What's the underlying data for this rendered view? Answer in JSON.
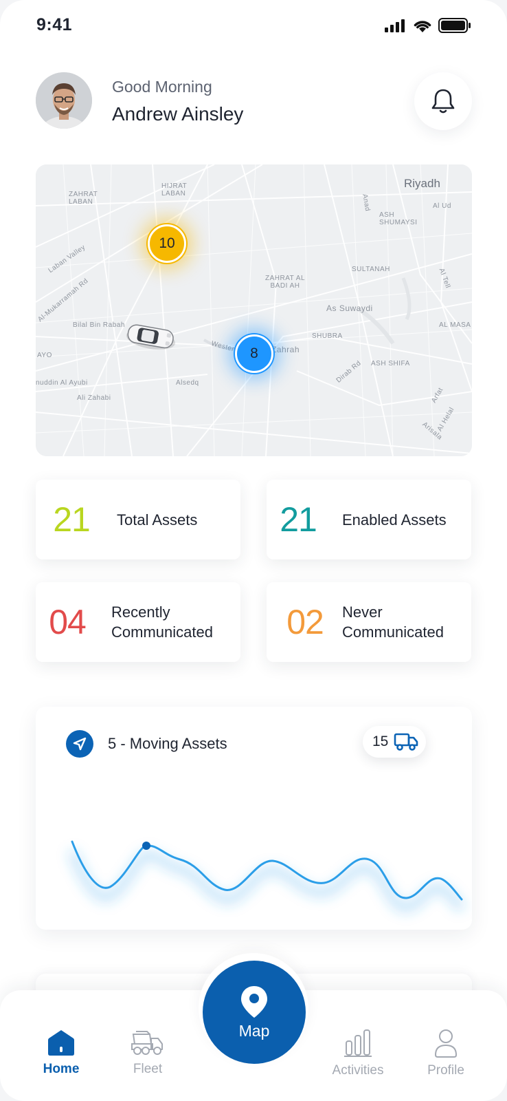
{
  "status_bar": {
    "time": "9:41"
  },
  "header": {
    "greeting": "Good Morning",
    "user_name": "Andrew Ainsley"
  },
  "map": {
    "labels": [
      "Riyadh",
      "HIJRAT LABAN",
      "ZAHRAT LABAN",
      "Al Ud",
      "ASH SHUMAYSI",
      "SULTANAH",
      "ZAHRAT AL BADI AH",
      "As Suwaydi",
      "SHUBRA",
      "AL MASA",
      "Bilal Bin Rabah",
      "Laban Valley",
      "Al-Mukarramah Rd",
      "Western",
      "Zahrah",
      "ASH SHIFA",
      "Dirab Rd",
      "Alsedq",
      "Ali Zahabi",
      "nuddin Al Ayubi",
      "Al Tell",
      "Arfat",
      "Al Helal",
      "Arisala",
      "Anad",
      "AYO"
    ],
    "clusters": [
      {
        "count": "10",
        "color": "#f6b800"
      },
      {
        "count": "8",
        "color": "#1e96ff"
      }
    ]
  },
  "stats": [
    {
      "value": "21",
      "label": "Total Assets",
      "color": "#b9d620"
    },
    {
      "value": "21",
      "label": "Enabled Assets",
      "color": "#129c9e"
    },
    {
      "value": "04",
      "label": "Recently Communicated",
      "color": "#e24b4b"
    },
    {
      "value": "02",
      "label": "Never Communicated",
      "color": "#f39a3b"
    }
  ],
  "moving": {
    "title": "5 - Moving Assets",
    "truck_count": "15",
    "accent": "#0b63b5",
    "line_color": "#2b9ee8"
  },
  "nav": {
    "home": "Home",
    "fleet": "Fleet",
    "map": "Map",
    "activities": "Activities",
    "profile": "Profile",
    "active_color": "#0b5fae",
    "inactive_color": "#a4a9b2"
  }
}
